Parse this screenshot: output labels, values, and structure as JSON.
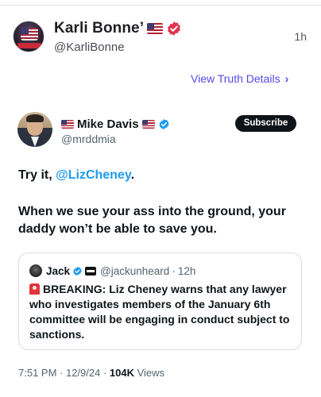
{
  "truth": {
    "display_name": "Karli Bonne’",
    "handle": "@KarliBonne",
    "timestamp": "1h",
    "view_details_label": "View Truth Details",
    "view_details_chevron": "›",
    "verified_color": "#e0344c",
    "link_color": "#5448ee"
  },
  "embedded_post": {
    "display_name": "Mike Davis",
    "handle": "@mrddmia",
    "subscribe_label": "Subscribe",
    "text_line1_prefix": "Try it, ",
    "text_line1_mention": "@LizCheney",
    "text_line1_suffix": ".",
    "text_line2": "When we sue your ass into the ground, your daddy won’t be able to save you.",
    "meta_time": "7:51 PM · 12/9/24 · ",
    "meta_views": "104K",
    "meta_views_label": " Views",
    "verified_color": "#1d9bf0",
    "mention_color": "#1d9bf0"
  },
  "quoted_post": {
    "display_name": "Jack",
    "handle": "@jackunheard",
    "separator": "·",
    "timestamp": "12h",
    "text": "BREAKING: Liz Cheney warns that any lawyer who investigates members of the January 6th committee will be engaging in conduct subject to sanctions."
  }
}
